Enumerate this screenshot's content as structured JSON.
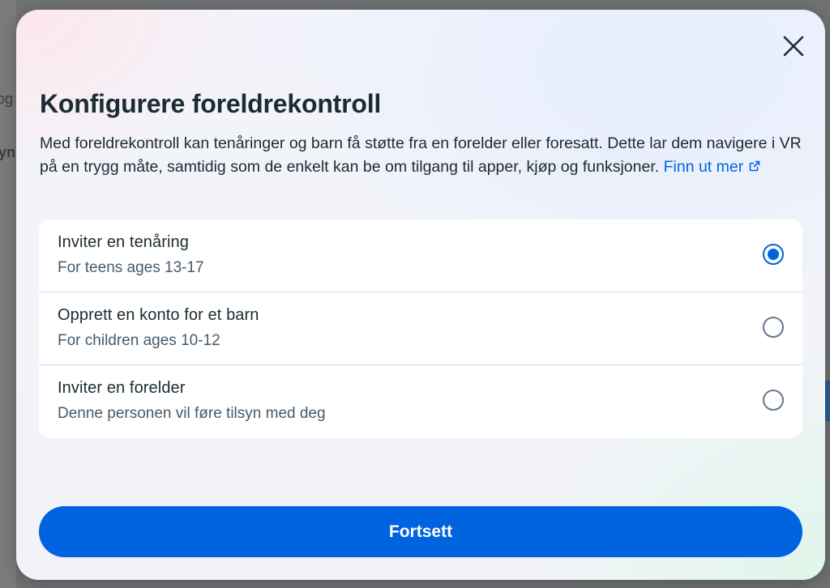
{
  "background_page": {
    "fragment_1": "og",
    "fragment_2": "yn"
  },
  "modal": {
    "title": "Konfigurere foreldrekontroll",
    "description": "Med foreldrekontroll kan tenåringer og barn få støtte fra en forelder eller foresatt. Dette lar dem navigere i VR på en trygg måte, samtidig som de enkelt kan be om tilgang til apper, kjøp og funksjoner.",
    "learn_more_label": "Finn ut mer",
    "options": [
      {
        "title": "Inviter en tenåring",
        "subtitle": "For teens ages 13-17",
        "selected": true
      },
      {
        "title": "Opprett en konto for et barn",
        "subtitle": "For children ages 10-12",
        "selected": false
      },
      {
        "title": "Inviter en forelder",
        "subtitle": "Denne personen vil føre tilsyn med deg",
        "selected": false
      }
    ],
    "continue_label": "Fortsett"
  },
  "icons": {
    "close": "close-icon",
    "external_link": "external-link-icon"
  },
  "colors": {
    "accent": "#0064e0",
    "text_primary": "#1c2b33",
    "text_secondary": "#465a69"
  }
}
